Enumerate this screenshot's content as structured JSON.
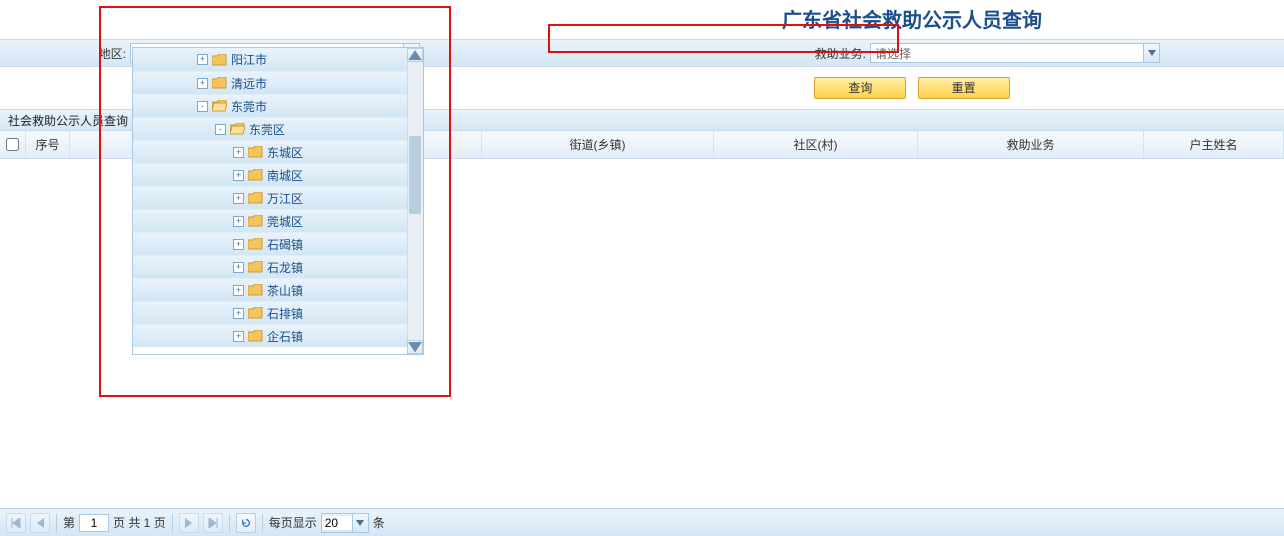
{
  "title": "广东省社会救助公示人员查询",
  "form": {
    "region_label": "地区:",
    "region_value": "",
    "biz_label": "救助业务:",
    "biz_value": "请选择"
  },
  "buttons": {
    "search": "查询",
    "reset": "重置"
  },
  "section_title": "社会救助公示人员查询",
  "grid": {
    "columns": [
      "",
      "序号",
      "",
      "街道(乡镇)",
      "社区(村)",
      "救助业务",
      "户主姓名"
    ]
  },
  "tree": {
    "nodes": [
      {
        "indent": 64,
        "expand": "+",
        "folder": "closed",
        "label": "阳江市"
      },
      {
        "indent": 64,
        "expand": "+",
        "folder": "closed",
        "label": "清远市"
      },
      {
        "indent": 64,
        "expand": "-",
        "folder": "open",
        "label": "东莞市"
      },
      {
        "indent": 82,
        "expand": "-",
        "folder": "open",
        "label": "东莞区"
      },
      {
        "indent": 100,
        "expand": "+",
        "folder": "closed",
        "label": "东城区"
      },
      {
        "indent": 100,
        "expand": "+",
        "folder": "closed",
        "label": "南城区"
      },
      {
        "indent": 100,
        "expand": "+",
        "folder": "closed",
        "label": "万江区"
      },
      {
        "indent": 100,
        "expand": "+",
        "folder": "closed",
        "label": "莞城区"
      },
      {
        "indent": 100,
        "expand": "+",
        "folder": "closed",
        "label": "石碣镇"
      },
      {
        "indent": 100,
        "expand": "+",
        "folder": "closed",
        "label": "石龙镇"
      },
      {
        "indent": 100,
        "expand": "+",
        "folder": "closed",
        "label": "茶山镇"
      },
      {
        "indent": 100,
        "expand": "+",
        "folder": "closed",
        "label": "石排镇"
      },
      {
        "indent": 100,
        "expand": "+",
        "folder": "closed",
        "label": "企石镇"
      }
    ]
  },
  "paging": {
    "prefix": "第",
    "current": "1",
    "middle": "页 共 1 页",
    "per_page_label": "每页显示",
    "page_size": "20",
    "unit": "条"
  }
}
